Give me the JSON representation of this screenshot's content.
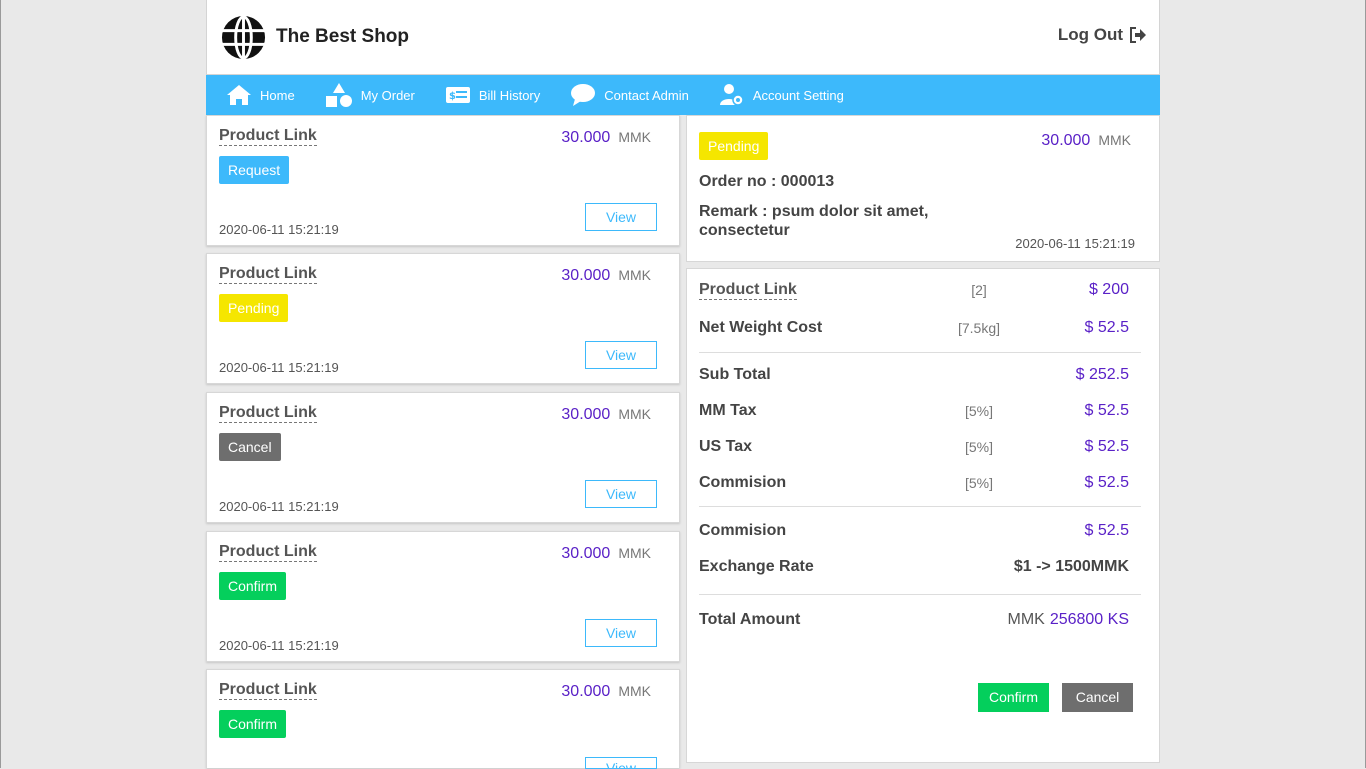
{
  "header": {
    "shop_name": "The Best Shop",
    "logout_label": "Log Out"
  },
  "nav": {
    "items": [
      {
        "label": "Home",
        "icon": "home-icon"
      },
      {
        "label": "My Order",
        "icon": "shapes-icon"
      },
      {
        "label": "Bill History",
        "icon": "bill-icon"
      },
      {
        "label": "Contact Admin",
        "icon": "chat-icon"
      },
      {
        "label": "Account Setting",
        "icon": "user-gear-icon"
      }
    ]
  },
  "orders": [
    {
      "link": "Product Link",
      "price": "30.000",
      "unit": "MMK",
      "status": "Request",
      "view": "View",
      "date": "2020-06-11 15:21:19"
    },
    {
      "link": "Product Link",
      "price": "30.000",
      "unit": "MMK",
      "status": "Pending",
      "view": "View",
      "date": "2020-06-11 15:21:19"
    },
    {
      "link": "Product Link",
      "price": "30.000",
      "unit": "MMK",
      "status": "Cancel",
      "view": "View",
      "date": "2020-06-11 15:21:19"
    },
    {
      "link": "Product Link",
      "price": "30.000",
      "unit": "MMK",
      "status": "Confirm",
      "view": "View",
      "date": "2020-06-11 15:21:19"
    },
    {
      "link": "Product Link",
      "price": "30.000",
      "unit": "MMK",
      "status": "Confirm",
      "view": "View",
      "date": ""
    }
  ],
  "detail": {
    "status": "Pending",
    "price": "30.000",
    "unit": "MMK",
    "order_no": "Order no : 000013",
    "remark": "Remark : psum dolor sit amet, consectetur",
    "date": "2020-06-11 15:21:19"
  },
  "summary": {
    "product_link": {
      "label": "Product Link",
      "qty": "[2]",
      "value": "$ 200"
    },
    "net_weight": {
      "label": "Net Weight Cost",
      "qty": "[7.5kg]",
      "value": "$ 52.5"
    },
    "sub_total": {
      "label": "Sub Total",
      "value": "$ 252.5"
    },
    "mm_tax": {
      "label": "MM Tax",
      "rate": "[5%]",
      "value": "$ 52.5"
    },
    "us_tax": {
      "label": "US Tax",
      "rate": "[5%]",
      "value": "$ 52.5"
    },
    "commision1": {
      "label": "Commision",
      "rate": "[5%]",
      "value": "$ 52.5"
    },
    "commision2": {
      "label": "Commision",
      "value": "$ 52.5"
    },
    "exchange": {
      "label": "Exchange Rate",
      "value": "$1 -> 1500MMK"
    },
    "total": {
      "label": "Total Amount",
      "currency": "MMK",
      "value": "256800 KS"
    },
    "confirm_label": "Confirm",
    "cancel_label": "Cancel"
  },
  "colors": {
    "accent": "#3db9fb",
    "price": "#5a21c7",
    "pending": "#f5e600",
    "confirm": "#04cf5c",
    "cancel": "#6e6e6e"
  }
}
